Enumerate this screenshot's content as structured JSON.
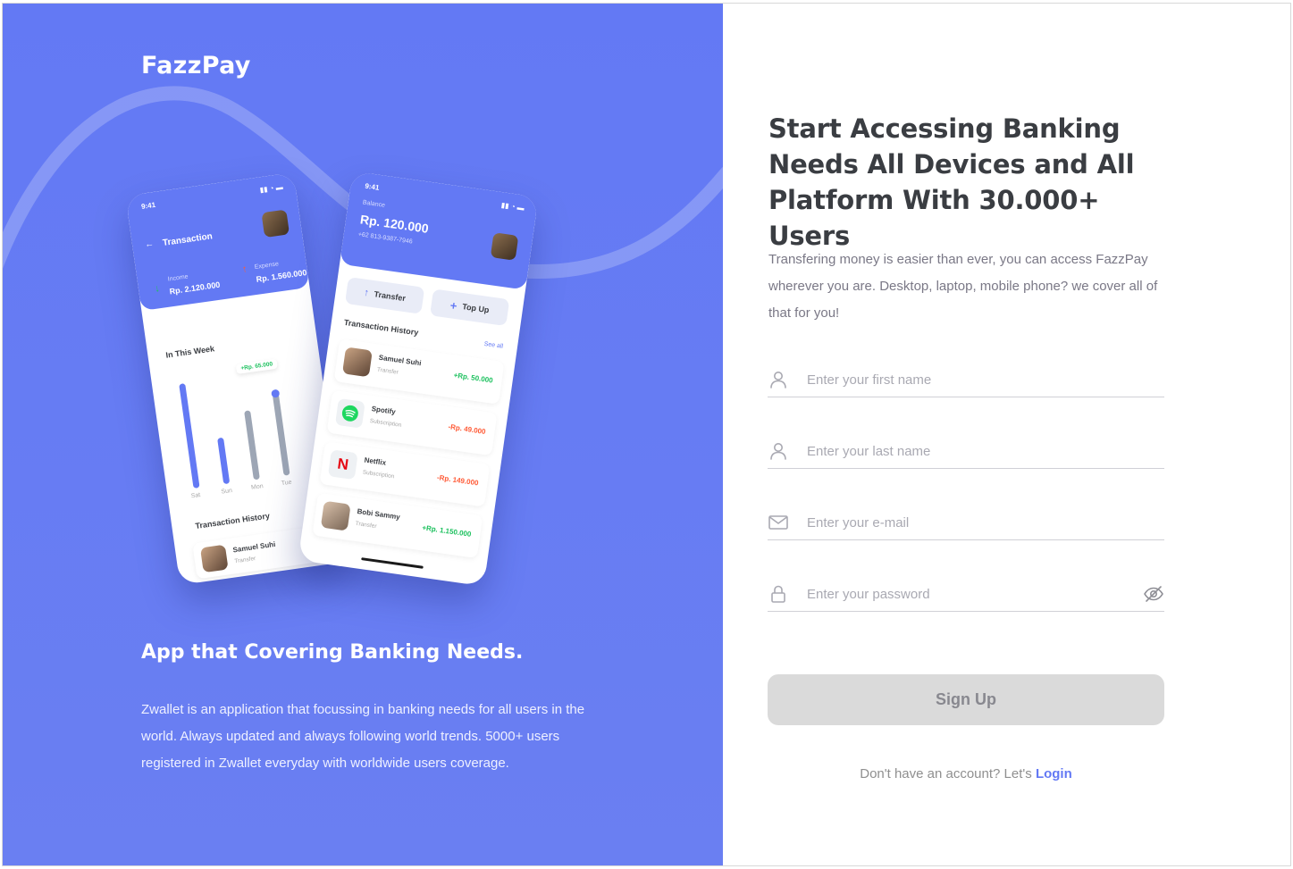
{
  "brand": {
    "name": "FazzPay"
  },
  "left": {
    "heading": "App that Covering Banking Needs.",
    "description": "Zwallet is an application that focussing in banking needs for all users in the world. Always updated and always following world trends. 5000+ users registered in Zwallet everyday with worldwide users coverage."
  },
  "phone_left": {
    "time": "9:41",
    "title": "Transaction",
    "income_label": "Income",
    "income_value": "Rp. 2.120.000",
    "expense_label": "Expense",
    "expense_value": "Rp. 1.560.000",
    "week_label": "In This Week",
    "tooltip": "+Rp. 65.000",
    "days": [
      "Sat",
      "Sun",
      "Mon",
      "Tue"
    ],
    "history_label": "Transaction History",
    "row_name": "Samuel Suhi",
    "row_sub": "Transfer"
  },
  "phone_right": {
    "time": "9:41",
    "balance_label": "Balance",
    "balance_value": "Rp. 120.000",
    "phone_number": "+62 813-9387-7946",
    "transfer_label": "Transfer",
    "topup_label": "Top Up",
    "history_label": "Transaction History",
    "see_all": "See all",
    "transactions": [
      {
        "name": "Samuel Suhi",
        "type": "Transfer",
        "amount": "+Rp. 50.000",
        "color": "#1ec15f"
      },
      {
        "name": "Spotify",
        "type": "Subscription",
        "amount": "-Rp. 49.000",
        "color": "#ff5b37"
      },
      {
        "name": "Netflix",
        "type": "Subscription",
        "amount": "-Rp. 149.000",
        "color": "#ff5b37"
      },
      {
        "name": "Bobi Sammy",
        "type": "Transfer",
        "amount": "+Rp. 1.150.000",
        "color": "#1ec15f"
      }
    ]
  },
  "right": {
    "title": "Start Accessing Banking Needs All Devices and All Platform With 30.000+ Users",
    "description": "Transfering money is easier than ever, you can access FazzPay wherever you are. Desktop, laptop, mobile phone? we cover all of that for you!"
  },
  "form": {
    "first_name_placeholder": "Enter your first name",
    "last_name_placeholder": "Enter your last name",
    "email_placeholder": "Enter your e-mail",
    "password_placeholder": "Enter your password",
    "submit_label": "Sign Up",
    "footer_text": "Don't have an account? Let's",
    "footer_link": "Login"
  },
  "colors": {
    "primary": "#6379f4",
    "text_dark": "#3a3d42",
    "text_muted": "#7a7886",
    "button_disabled": "#dadada",
    "income": "#1ec15f",
    "expense": "#ff5b37"
  }
}
